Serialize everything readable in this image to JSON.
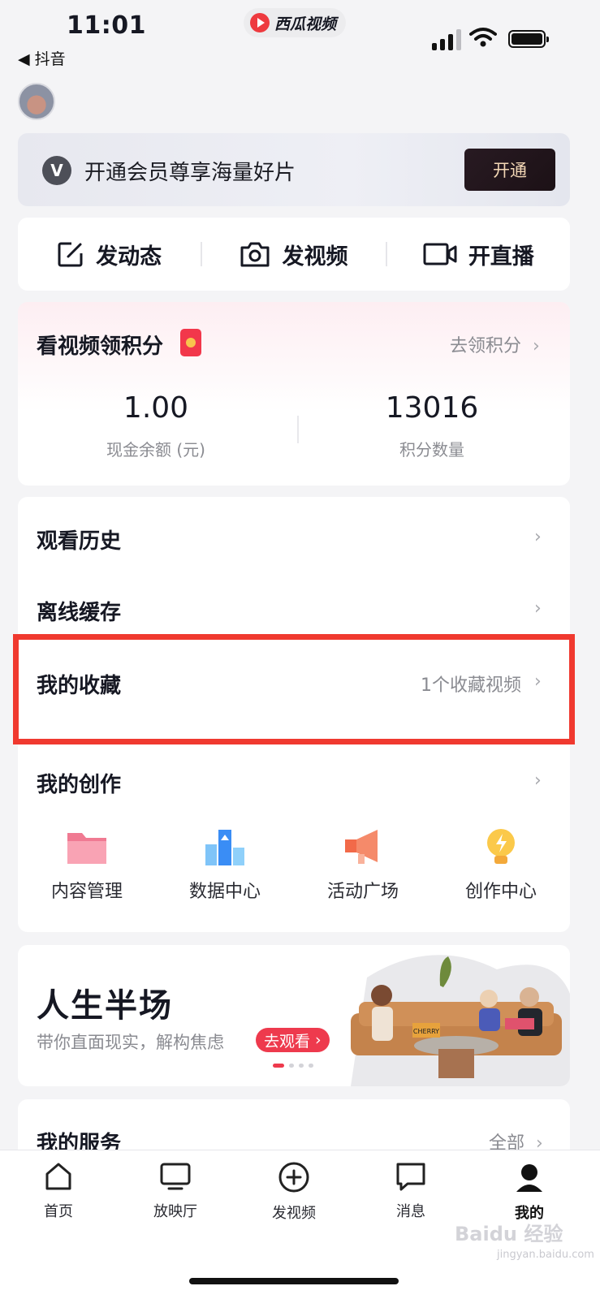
{
  "status_bar": {
    "time": "11:01",
    "back_app": "◀ 抖音",
    "app_name": "西瓜视频"
  },
  "vip_banner": {
    "text": "开通会员尊享海量好片",
    "button": "开通"
  },
  "quick_actions": [
    {
      "label": "发动态",
      "icon": "edit-icon"
    },
    {
      "label": "发视频",
      "icon": "camera-icon"
    },
    {
      "label": "开直播",
      "icon": "live-camera-icon"
    }
  ],
  "points": {
    "title": "看视频领积分",
    "link": "去领积分",
    "cash_value": "1.00",
    "cash_label": "现金余额 (元)",
    "points_value": "13016",
    "points_label": "积分数量"
  },
  "list": {
    "history": "观看历史",
    "offline": "离线缓存",
    "favorites": "我的收藏",
    "favorites_value": "1个收藏视频",
    "creation": "我的创作"
  },
  "tools": [
    {
      "label": "内容管理",
      "icon": "folder-icon"
    },
    {
      "label": "数据中心",
      "icon": "bar-chart-icon"
    },
    {
      "label": "活动广场",
      "icon": "megaphone-icon"
    },
    {
      "label": "创作中心",
      "icon": "lightbulb-icon"
    }
  ],
  "promo": {
    "title": "人生半场",
    "subtitle": "带你直面现实，解构焦虑",
    "button": "去观看",
    "poster_caption": "CHERRY"
  },
  "services": {
    "title": "我的服务",
    "link": "全部"
  },
  "tabs": [
    {
      "label": "首页",
      "icon": "home-icon"
    },
    {
      "label": "放映厅",
      "icon": "tv-icon"
    },
    {
      "label": "发视频",
      "icon": "plus-circle-icon"
    },
    {
      "label": "消息",
      "icon": "message-icon"
    },
    {
      "label": "我的",
      "icon": "profile-icon"
    }
  ],
  "watermark": {
    "brand": "Baidu 经验",
    "url": "jingyan.baidu.com"
  },
  "colors": {
    "accent": "#ee3a4d",
    "highlight_box": "#f0392f",
    "muted_text": "#8a8b91"
  }
}
